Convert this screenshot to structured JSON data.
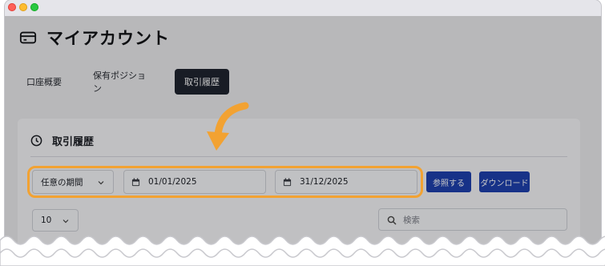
{
  "page": {
    "title": "マイアカウント",
    "title_icon": "credit-card-icon"
  },
  "tabs": [
    {
      "label": "口座概要",
      "active": false
    },
    {
      "label": "保有ポジション",
      "active": false
    },
    {
      "label": "取引履歴",
      "active": true
    }
  ],
  "section": {
    "title": "取引履歴",
    "icon": "clock-icon"
  },
  "filters": {
    "period": "任意の期間",
    "from_date": "01/01/2025",
    "to_date": "31/12/2025",
    "reference_button": "参照する",
    "download_button": "ダウンロード"
  },
  "table_controls": {
    "page_size": "10",
    "search_placeholder": "検索"
  },
  "colors": {
    "primary_button": "#1e40af",
    "active_tab": "#1f2430",
    "highlight": "#f2a232"
  }
}
